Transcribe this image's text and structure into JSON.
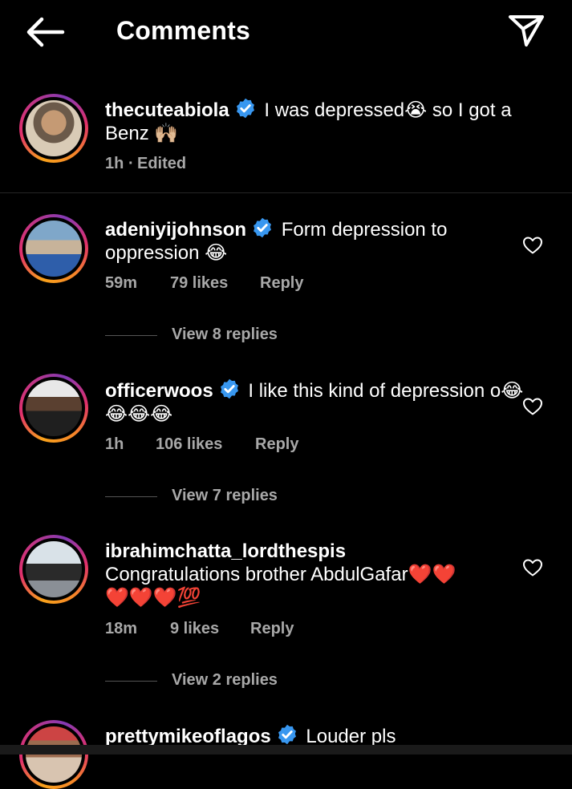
{
  "header": {
    "title": "Comments",
    "back_icon": "arrow-left-icon",
    "send_icon": "paper-plane-icon"
  },
  "colors": {
    "background": "#000000",
    "text": "#ffffff",
    "muted": "#a8a8a8",
    "verified": "#3897f0"
  },
  "caption": {
    "username": "thecuteabiola",
    "verified": true,
    "text": "I was depressed😭 so I got a Benz 🙌🏼",
    "time": "1h",
    "separator": "·",
    "edited": "Edited"
  },
  "comments": [
    {
      "username": "adeniyijohnson",
      "verified": true,
      "text": "Form depression to oppression 😂",
      "time": "59m",
      "likes": "79 likes",
      "reply": "Reply",
      "view_replies": "View 8 replies"
    },
    {
      "username": "officerwoos",
      "verified": true,
      "text": "I like this kind of depression o😂😂😂😂",
      "time": "1h",
      "likes": "106 likes",
      "reply": "Reply",
      "view_replies": "View 7 replies"
    },
    {
      "username": "ibrahimchatta_lordthespis",
      "verified": false,
      "text": "Congratulations brother AbdulGafar❤️❤️❤️❤️❤️💯",
      "time": "18m",
      "likes": "9 likes",
      "reply": "Reply",
      "view_replies": "View 2 replies"
    },
    {
      "username": "prettymikeoflagos",
      "verified": true,
      "text": "Louder pls"
    }
  ]
}
